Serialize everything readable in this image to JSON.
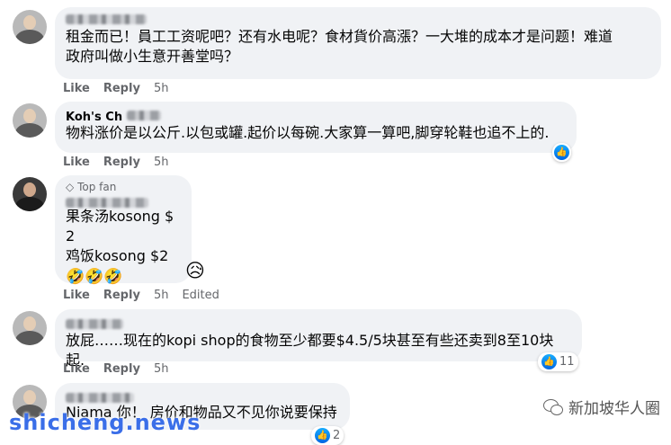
{
  "comments": [
    {
      "author": "",
      "text": "租金而已！員工工资呢吧？还有水电呢？食材貨价高漲？一大堆的成本才是问题！难道\n政府叫做小生意开善堂吗？",
      "like": "Like",
      "reply": "Reply",
      "time": "5h"
    },
    {
      "author": "Koh's Ch",
      "text": "物料涨价是以公斤.以包或罐.起价以每碗.大家算一算吧,脚穿轮鞋也追不上的.",
      "like": "Like",
      "reply": "Reply",
      "time": "5h",
      "reaction_icon": "like-icon"
    },
    {
      "badge": "Top fan",
      "text": "果条汤kosong $ 2\n鸡饭kosong $2",
      "emojis": "🤣🤣🤣",
      "like": "Like",
      "reply": "Reply",
      "time": "5h",
      "edited": "Edited",
      "reaction_icon": "sad-face-icon"
    },
    {
      "text": "放屁……现在的kopi shop的食物至少都要$4.5/5块甚至有些还卖到8至10块起.",
      "like": "Like",
      "reply": "Reply",
      "time": "5h",
      "reaction_count": "11"
    },
    {
      "text": "Niama 你！ 房价和物品又不见你说要保持",
      "reaction_count": "2"
    }
  ],
  "watermarks": {
    "left": "shicheng.news",
    "right": "新加坡华人圈"
  },
  "colors": {
    "bubble": "#f0f2f5",
    "meta": "#65676b",
    "like_blue": "#1877f2"
  }
}
